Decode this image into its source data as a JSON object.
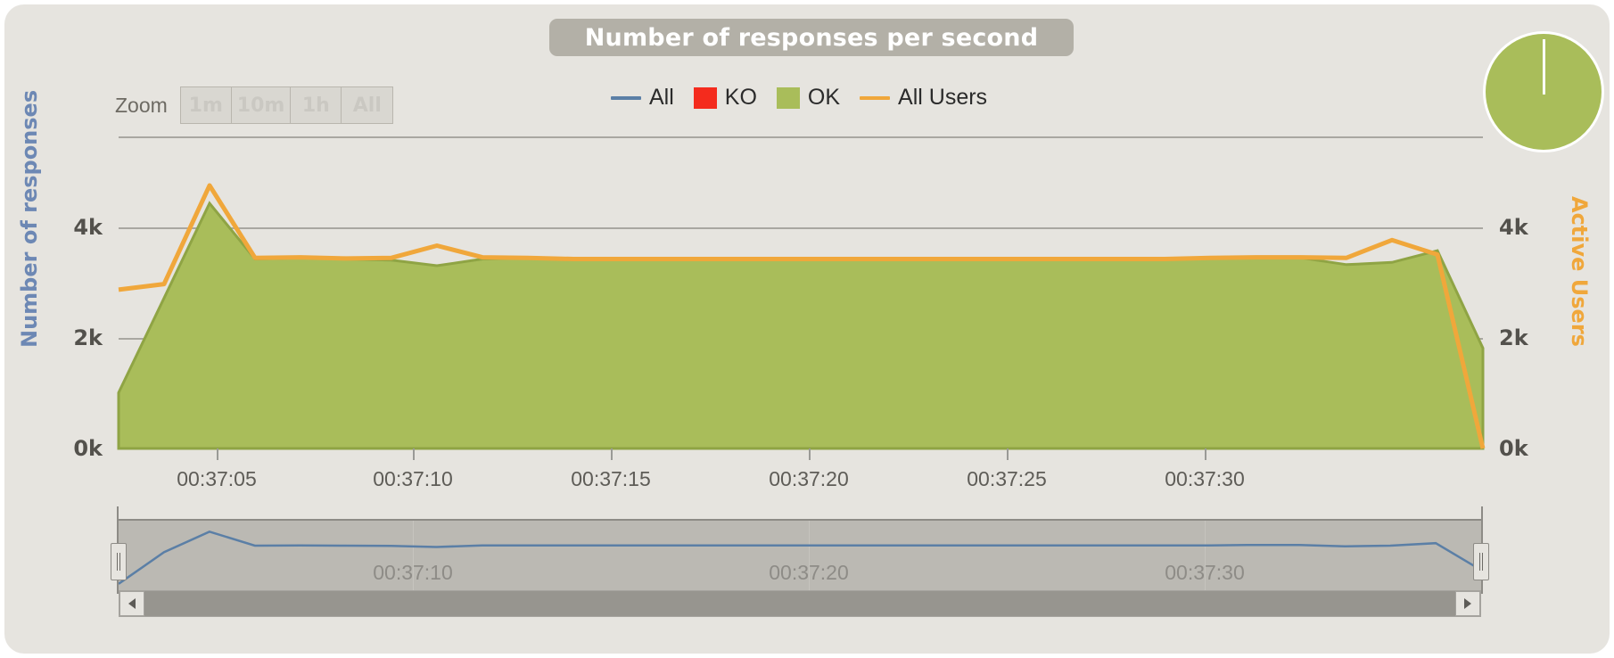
{
  "title": "Number of responses per second",
  "zoom": {
    "label": "Zoom",
    "buttons": [
      {
        "label": "1m"
      },
      {
        "label": "10m"
      },
      {
        "label": "1h"
      },
      {
        "label": "All"
      }
    ]
  },
  "legend": [
    {
      "label": "All",
      "type": "line",
      "color": "#5b7fa6"
    },
    {
      "label": "KO",
      "type": "box",
      "color": "#f42b1d"
    },
    {
      "label": "OK",
      "type": "box",
      "color": "#a9bd5a"
    },
    {
      "label": "All Users",
      "type": "line",
      "color": "#f0a73b"
    }
  ],
  "axes": {
    "left_title": "Number of responses",
    "left_title_color": "#6d88b4",
    "right_title": "Active Users",
    "right_title_color": "#f0a73b",
    "y_ticks": [
      "0k",
      "2k",
      "4k"
    ],
    "x_ticks": [
      "00:37:05",
      "00:37:10",
      "00:37:15",
      "00:37:20",
      "00:37:25",
      "00:37:30"
    ]
  },
  "navigator": {
    "x_ticks": [
      "00:37:10",
      "00:37:20",
      "00:37:30"
    ],
    "left_handle": "range-handle-left",
    "right_handle": "range-handle-right",
    "scroll_left": "◄",
    "scroll_right": "►"
  },
  "pie": {
    "slices": [
      {
        "label": "OK",
        "value": 100,
        "color": "#a9bd5a"
      }
    ]
  },
  "chart_data": {
    "type": "area",
    "title": "Number of responses per second",
    "xlabel": "",
    "ylabel": "Number of responses",
    "y2label": "Active Users",
    "ylim": [
      0,
      5600
    ],
    "y2lim": [
      0,
      5600
    ],
    "yticks": [
      0,
      2000,
      4000
    ],
    "ytick_labels": [
      "0k",
      "2k",
      "4k"
    ],
    "grid": true,
    "legend_position": "top-center",
    "x": [
      "00:37:03",
      "00:37:04",
      "00:37:05",
      "00:37:06",
      "00:37:07",
      "00:37:08",
      "00:37:09",
      "00:37:10",
      "00:37:11",
      "00:37:12",
      "00:37:13",
      "00:37:14",
      "00:37:15",
      "00:37:16",
      "00:37:17",
      "00:37:18",
      "00:37:19",
      "00:37:20",
      "00:37:21",
      "00:37:22",
      "00:37:23",
      "00:37:24",
      "00:37:25",
      "00:37:26",
      "00:37:27",
      "00:37:28",
      "00:37:29",
      "00:37:30",
      "00:37:31",
      "00:37:32",
      "00:37:33"
    ],
    "series": [
      {
        "name": "OK",
        "type": "area",
        "color": "#a9bd5a",
        "axis": "left",
        "values": [
          1000,
          2700,
          4400,
          3400,
          3420,
          3400,
          3380,
          3280,
          3400,
          3420,
          3400,
          3400,
          3400,
          3400,
          3400,
          3400,
          3400,
          3400,
          3400,
          3400,
          3400,
          3400,
          3400,
          3400,
          3420,
          3430,
          3420,
          3300,
          3340,
          3550,
          1800
        ]
      },
      {
        "name": "KO",
        "type": "area",
        "color": "#f42b1d",
        "axis": "left",
        "values": [
          0,
          0,
          0,
          0,
          0,
          0,
          0,
          0,
          0,
          0,
          0,
          0,
          0,
          0,
          0,
          0,
          0,
          0,
          0,
          0,
          0,
          0,
          0,
          0,
          0,
          0,
          0,
          0,
          0,
          0,
          0
        ]
      },
      {
        "name": "All Users",
        "type": "line",
        "color": "#f0a73b",
        "axis": "right",
        "values": [
          2850,
          2950,
          4720,
          3420,
          3430,
          3410,
          3420,
          3640,
          3430,
          3420,
          3400,
          3400,
          3400,
          3400,
          3400,
          3400,
          3400,
          3400,
          3400,
          3400,
          3400,
          3400,
          3400,
          3400,
          3420,
          3430,
          3430,
          3420,
          3740,
          3480,
          0
        ]
      },
      {
        "name": "All",
        "type": "line",
        "color": "#5b7fa6",
        "axis": "left",
        "values": [
          1000,
          2700,
          4400,
          3400,
          3420,
          3400,
          3380,
          3280,
          3400,
          3420,
          3400,
          3400,
          3400,
          3400,
          3400,
          3400,
          3400,
          3400,
          3400,
          3400,
          3400,
          3400,
          3400,
          3400,
          3420,
          3430,
          3420,
          3300,
          3340,
          3550,
          1800
        ]
      }
    ],
    "navigator_series": {
      "name": "All",
      "color": "#5b7fa6",
      "values": [
        600,
        2900,
        4400,
        3380,
        3400,
        3380,
        3360,
        3280,
        3400,
        3400,
        3390,
        3390,
        3390,
        3390,
        3390,
        3390,
        3390,
        3390,
        3390,
        3390,
        3390,
        3390,
        3390,
        3390,
        3400,
        3430,
        3430,
        3330,
        3380,
        3560,
        1600
      ]
    }
  }
}
